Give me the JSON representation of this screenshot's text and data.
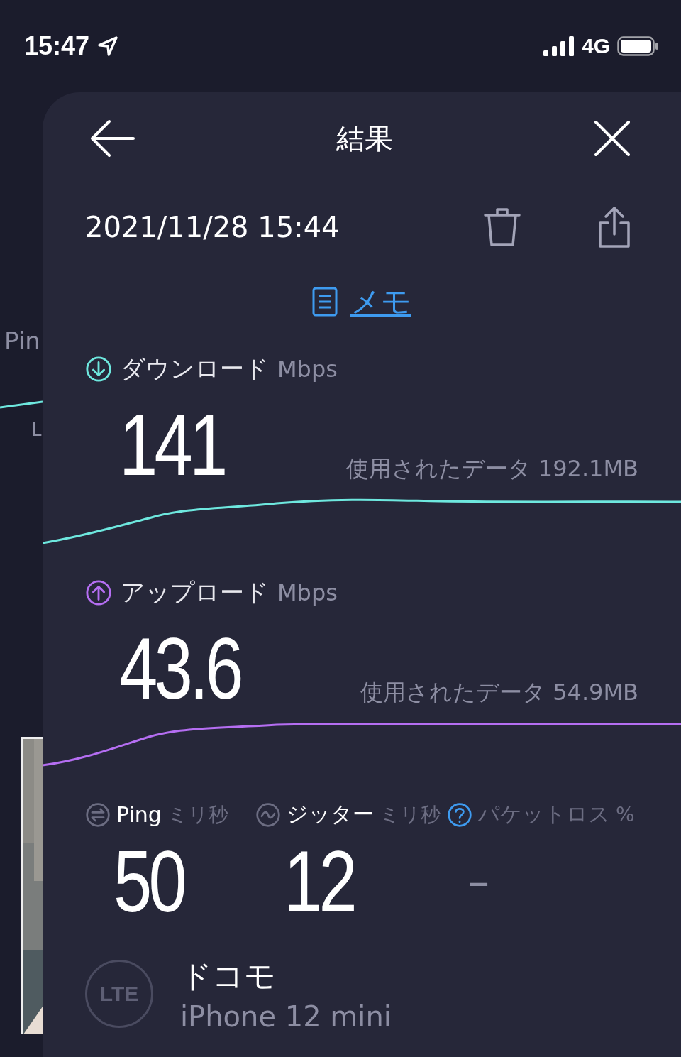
{
  "status_bar": {
    "time": "15:47",
    "network": "4G"
  },
  "background": {
    "label_1": "Pin",
    "label_2": "L"
  },
  "header": {
    "title": "結果"
  },
  "date": "2021/11/28 15:44",
  "memo_link": "メモ",
  "metrics": [
    {
      "kind": "download",
      "label": "ダウンロード",
      "unit": "Mbps",
      "value": "141",
      "data_used": "使用されたデータ 192.1MB",
      "color": "#6ee8df"
    },
    {
      "kind": "upload",
      "label": "アップロード",
      "unit": "Mbps",
      "value": "43.6",
      "data_used": "使用されたデータ 54.9MB",
      "color": "#b56ef2"
    }
  ],
  "stats": [
    {
      "kind": "ping",
      "label": "Ping",
      "unit": "ミリ秒",
      "value": "50",
      "disabled": false
    },
    {
      "kind": "jitter",
      "label": "ジッター",
      "unit": "ミリ秒",
      "value": "12",
      "disabled": false
    },
    {
      "kind": "packet_loss",
      "label": "パケットロス",
      "unit": "%",
      "value": "–",
      "disabled": true
    }
  ],
  "connection": {
    "badge": "LTE",
    "carrier": "ドコモ",
    "device": "iPhone 12 mini"
  }
}
